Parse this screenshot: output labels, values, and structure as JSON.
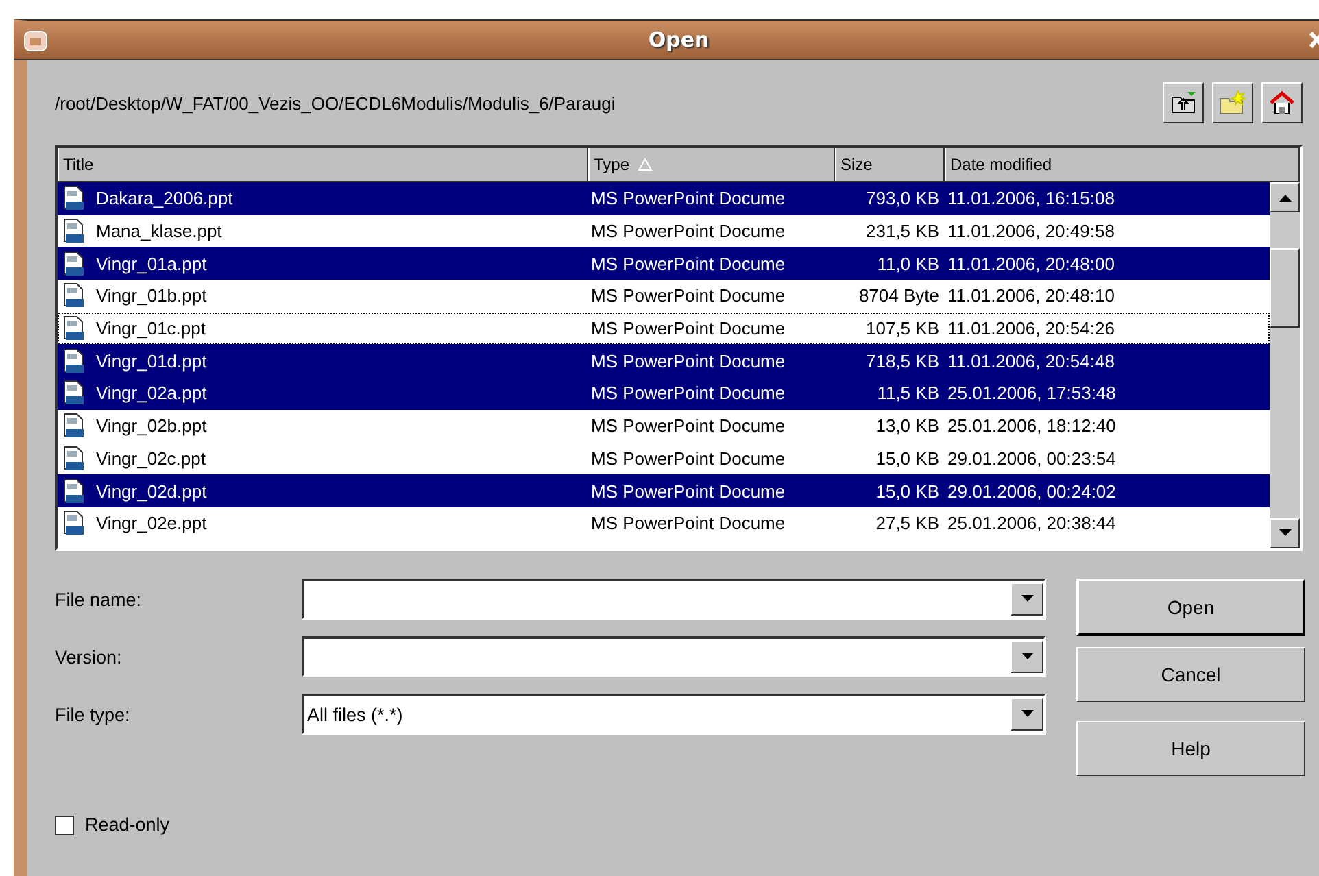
{
  "window": {
    "title": "Open"
  },
  "path": "/root/Desktop/W_FAT/00_Vezis_OO/ECDL6Modulis/Modulis_6/Paraugi",
  "toolbar": [
    {
      "kind": "up"
    },
    {
      "kind": "new-folder"
    },
    {
      "kind": "home"
    }
  ],
  "table": {
    "columns": [
      {
        "label": "Title",
        "sorted": false
      },
      {
        "label": "Type",
        "sorted": true
      },
      {
        "label": "Size",
        "sorted": false
      },
      {
        "label": "Date modified",
        "sorted": false
      }
    ],
    "rows": [
      {
        "title": "Dakara_2006.ppt",
        "type": "MS PowerPoint Docume",
        "size": "793,0 KB",
        "date": "11.01.2006, 16:15:08",
        "selected": true,
        "focused": false
      },
      {
        "title": "Mana_klase.ppt",
        "type": "MS PowerPoint Docume",
        "size": "231,5 KB",
        "date": "11.01.2006, 20:49:58",
        "selected": false,
        "focused": false
      },
      {
        "title": "Vingr_01a.ppt",
        "type": "MS PowerPoint Docume",
        "size": "11,0 KB",
        "date": "11.01.2006, 20:48:00",
        "selected": true,
        "focused": false
      },
      {
        "title": "Vingr_01b.ppt",
        "type": "MS PowerPoint Docume",
        "size": "8704 Byte",
        "date": "11.01.2006, 20:48:10",
        "selected": false,
        "focused": false
      },
      {
        "title": "Vingr_01c.ppt",
        "type": "MS PowerPoint Docume",
        "size": "107,5 KB",
        "date": "11.01.2006, 20:54:26",
        "selected": false,
        "focused": true
      },
      {
        "title": "Vingr_01d.ppt",
        "type": "MS PowerPoint Docume",
        "size": "718,5 KB",
        "date": "11.01.2006, 20:54:48",
        "selected": true,
        "focused": false
      },
      {
        "title": "Vingr_02a.ppt",
        "type": "MS PowerPoint Docume",
        "size": "11,5 KB",
        "date": "25.01.2006, 17:53:48",
        "selected": true,
        "focused": false
      },
      {
        "title": "Vingr_02b.ppt",
        "type": "MS PowerPoint Docume",
        "size": "13,0 KB",
        "date": "25.01.2006, 18:12:40",
        "selected": false,
        "focused": false
      },
      {
        "title": "Vingr_02c.ppt",
        "type": "MS PowerPoint Docume",
        "size": "15,0 KB",
        "date": "29.01.2006, 00:23:54",
        "selected": false,
        "focused": false
      },
      {
        "title": "Vingr_02d.ppt",
        "type": "MS PowerPoint Docume",
        "size": "15,0 KB",
        "date": "29.01.2006, 00:24:02",
        "selected": true,
        "focused": false
      },
      {
        "title": "Vingr_02e.ppt",
        "type": "MS PowerPoint Docume",
        "size": "27,5 KB",
        "date": "25.01.2006, 20:38:44",
        "selected": false,
        "focused": false
      }
    ]
  },
  "fields": [
    {
      "label": "File name:"
    },
    {
      "label": "Version:"
    },
    {
      "label": "File type:",
      "value": "All files (*.*)"
    }
  ],
  "buttons": [
    {
      "label": "Open",
      "default": true
    },
    {
      "label": "Cancel",
      "default": false
    },
    {
      "label": "Help",
      "default": false
    }
  ],
  "read_only": {
    "label": "Read-only",
    "checked": false
  }
}
